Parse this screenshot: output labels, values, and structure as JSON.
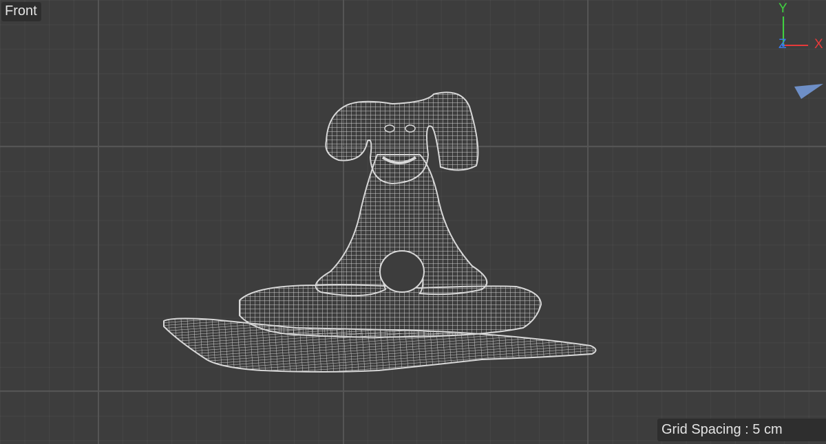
{
  "viewport": {
    "view_name": "Front",
    "grid_spacing_label": "Grid Spacing : 5 cm"
  },
  "axis_gizmo": {
    "y_label": "Y",
    "z_label": "Z",
    "x_label": "X",
    "y_color": "#3fd33f",
    "x_color": "#e83a3a",
    "z_color": "#3a7ae8"
  },
  "colors": {
    "background": "#3d3d3d",
    "wireframe": "#d8d8d8",
    "label_bg": "#2e2e2e"
  }
}
